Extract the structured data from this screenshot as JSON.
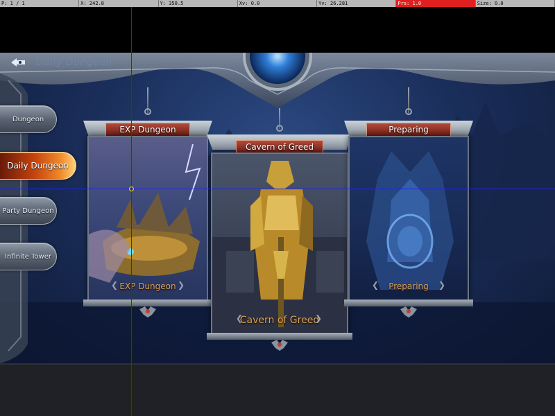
{
  "debug_bar": {
    "pointers": "P: 1 / 1",
    "x": "X: 242.8",
    "y": "Y: 350.5",
    "xv": "Xv: 0.0",
    "yv": "Yv: 26.281",
    "prs": "Prs: 1.0",
    "size": "Size: 0.0"
  },
  "header": {
    "back_icon": "back-arrow-icon",
    "title": "Daily Dungeon"
  },
  "menu": {
    "items": [
      {
        "label": "Dungeon",
        "active": false
      },
      {
        "label": "Daily Dungeon",
        "active": true
      },
      {
        "label": "Party Dungeon",
        "active": false
      },
      {
        "label": "Infinite Tower",
        "active": false
      }
    ]
  },
  "cards": [
    {
      "title": "EXP Dungeon",
      "footer": "EXP Dungeon",
      "art": "airship-fortress"
    },
    {
      "title": "Cavern of Greed",
      "footer": "Cavern of Greed",
      "art": "golden-armored-knight"
    },
    {
      "title": "Preparing",
      "footer": "Preparing",
      "art": "blue-crystal-gate"
    }
  ],
  "colors": {
    "active_menu": "#f08a2a",
    "header_plate": "#8e2a20",
    "footer_text": "#e2a052",
    "warn_cell": "#e02020",
    "crosshair": "#2020ff"
  }
}
